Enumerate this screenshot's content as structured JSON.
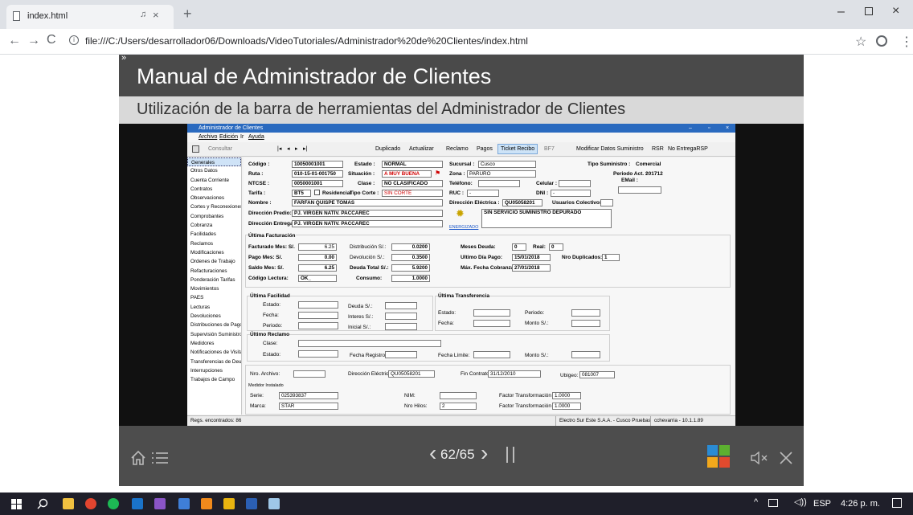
{
  "browser": {
    "tab_title": "index.html",
    "url": "file:///C:/Users/desarrollador06/Downloads/VideoTutoriales/Administrador%20de%20Clientes/index.html"
  },
  "viewer": {
    "collapse_glyph": "»",
    "title": "Manual de Administrador de Clientes",
    "subtitle": "Utilización de la barra de herramientas  del Administrador de Clientes",
    "page_counter": "62/65"
  },
  "app": {
    "window_title": "Administrador de Clientes",
    "menu": [
      "Archivo",
      "Edición",
      "Ir",
      "Ayuda"
    ],
    "toolbar": {
      "consultar": "Consultar",
      "duplicado": "Duplicado",
      "actualizar": "Actualizar",
      "reclamo": "Reclamo",
      "pagos": "Pagos",
      "ticket_recibo": "Ticket Recibo",
      "bf7": "BF7",
      "modificar": "Modificar Datos Suministro",
      "rsr": "RSR",
      "no_entrega": "No EntregaRSP"
    },
    "nav_items": [
      "Generales",
      "Otros Datos",
      "Cuenta Corriente",
      "Contratos",
      "Observaciones",
      "Cortes y Reconexiones",
      "Comprobantes",
      "Cobranza",
      "Facilidades",
      "Reclamos",
      "Modificaciones",
      "Ordenes de Trabajo",
      "Refacturaciones",
      "Ponderación Tarifas",
      "Movimientos",
      "PAES",
      "Lecturas",
      "Devoluciones",
      "Distribuciones de Pago",
      "Supervisión Suministro",
      "Medidores",
      "Notificaciones de Visita",
      "Transferencias de Deuda",
      "Interrupciones",
      "Trabajos de Campo"
    ],
    "general": {
      "codigo_label": "Código :",
      "codigo": "10050001001",
      "estado_label": "Estado :",
      "estado": "NORMAL",
      "sucursal_label": "Sucursal :",
      "sucursal": "Cusco",
      "tipo_sum_label": "Tipo Suministro :",
      "tipo_sum": "Comercial",
      "ruta_label": "Ruta :",
      "ruta": "010-15-01-001750",
      "situacion_label": "Situación :",
      "situacion": "A MUY BUENA",
      "zona_label": "Zona :",
      "zona": "PARURO",
      "periodo_label": "Periodo Act. :",
      "periodo": "201712",
      "ntcse_label": "NTCSE :",
      "ntcse": "0050001001",
      "clase_label": "Clase :",
      "clase": "NO CLASIFICADO",
      "telefono_label": "Teléfono:",
      "celular_label": "Celular :",
      "email_label": "EMail :",
      "tarifa_label": "Tarifa :",
      "tarifa": "BT5",
      "residencial_label": "Residencial",
      "tipo_corte_label": "Tipo Corte :",
      "tipo_corte": "SIN CORTE",
      "ruc_label": "RUC :",
      "ruc": "-",
      "dni_label": "DNI :",
      "dni": "-",
      "nombre_label": "Nombre :",
      "nombre": "FARFAN QUISPE TOMAS",
      "dir_electrica_label": "Dirección Eléctrica :",
      "dir_electrica": "QU05058201",
      "usuarios_label": "Usuarios Colectivos",
      "dir_predio_label": "Dirección Predio:",
      "dir_predio": "PJ. VIRGEN NATIV. PACCAREC",
      "servicio": "SIN SERVICIO SUMINISTRO DEPURADO",
      "dir_entrega_label": "Dirección Entrega:",
      "dir_entrega": "PJ. VIRGEN NATIV. PACCAREC",
      "energizado": "ENERGIZADO"
    },
    "facturacion": {
      "header": "Última Facturación",
      "facturado_label": "Facturado Mes: S/.",
      "facturado": "6.25",
      "distribucion_label": "Distribución S/.:",
      "distribucion": "0.0200",
      "meses_deuda_label": "Meses Deuda:",
      "meses_deuda": "0",
      "real_label": "Real:",
      "real": "0",
      "pago_mes_label": "Pago Mes: S/.",
      "pago_mes": "0.00",
      "devolucion_label": "Devolución S/.:",
      "devolucion": "0.3500",
      "ultimo_pago_label": "Ultimo Día Pago:",
      "ultimo_pago": "15/01/2018",
      "nro_dup_label": "Nro Duplicados:",
      "nro_dup": "1",
      "saldo_label": "Saldo Mes: S/.",
      "saldo": "6.25",
      "deuda_total_label": "Deuda Total S/.:",
      "deuda_total": "5.9200",
      "max_cobranza_label": "Máx. Fecha Cobranza:",
      "max_cobranza": "27/01/2018",
      "codigo_lectura_label": "Código Lectura:",
      "codigo_lectura": "OK_",
      "consumo_label": "Consumo:",
      "consumo": "1.0000"
    },
    "facilidad": {
      "header": "Última Facilidad",
      "estado": "Estado:",
      "fecha": "Fecha:",
      "periodo": "Periodo:",
      "deuda": "Deuda S/.:",
      "interes": "Interes S/.:",
      "inicial": "Inicial S/.:"
    },
    "transferencia": {
      "header": "Última Transferencia",
      "estado": "Estado:",
      "periodo": "Periodo:",
      "fecha": "Fecha:",
      "monto": "Monto S/.:"
    },
    "reclamo": {
      "header": "Último Reclamo",
      "clase": "Clase:",
      "estado": "Estado:",
      "fecha_registro": "Fecha Registro:",
      "fecha_limite": "Fecha Límite:",
      "monto": "Monto S/.:"
    },
    "archivo": {
      "nro_archivo": "Nro. Archivo:",
      "dir_electrica_label": "Dirección Eléctrica:",
      "dir_electrica": "QU05058201",
      "fin_contrato_label": "Fin Contrato:",
      "fin_contrato": "31/12/2010",
      "ubigeo_label": "Ubigeo:",
      "ubigeo": "081007"
    },
    "medidor": {
      "header": "Medidor Instalado",
      "serie_label": "Serie:",
      "serie": "025393837",
      "nim_label": "NIM:",
      "factor_ea_label": "Factor Transformación EA:",
      "factor_ea": "1.0000",
      "marca_label": "Marca:",
      "marca": "STAR",
      "nro_hilos_label": "Nro Hilos:",
      "nro_hilos": "2",
      "factor_er_label": "Factor Transformación ER:",
      "factor_er": "1.0000"
    },
    "status": {
      "registros": "Regs. encontrados: 86",
      "empresa": "Electro Sur Este S.A.A. - Cusco Pruebas",
      "usuario": "cchevarria - 10.1.1.89"
    }
  },
  "taskbar": {
    "lang": "ESP",
    "time": "4:26 p. m."
  }
}
